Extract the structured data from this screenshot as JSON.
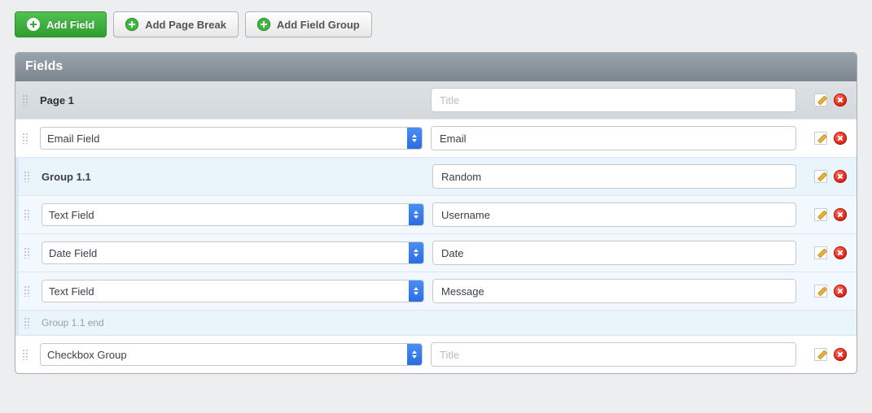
{
  "toolbar": {
    "add_field": "Add Field",
    "add_page_break": "Add Page Break",
    "add_field_group": "Add Field Group"
  },
  "panel": {
    "title": "Fields"
  },
  "placeholders": {
    "title": "Title"
  },
  "field_type_options": [
    "Email Field",
    "Text Field",
    "Date Field",
    "Checkbox Group"
  ],
  "rows": [
    {
      "kind": "page",
      "label": "Page 1",
      "title_value": "",
      "title_placeholder": "Title"
    },
    {
      "kind": "field",
      "field_type": "Email Field",
      "title_value": "Email"
    },
    {
      "kind": "group",
      "label": "Group 1.1",
      "title_value": "Random"
    },
    {
      "kind": "field",
      "in_group": true,
      "field_type": "Text Field",
      "title_value": "Username"
    },
    {
      "kind": "field",
      "in_group": true,
      "field_type": "Date Field",
      "title_value": "Date"
    },
    {
      "kind": "field",
      "in_group": true,
      "field_type": "Text Field",
      "title_value": "Message"
    },
    {
      "kind": "group-end",
      "label": "Group 1.1 end"
    },
    {
      "kind": "field",
      "field_type": "Checkbox Group",
      "title_value": "",
      "title_placeholder": "Title"
    }
  ]
}
